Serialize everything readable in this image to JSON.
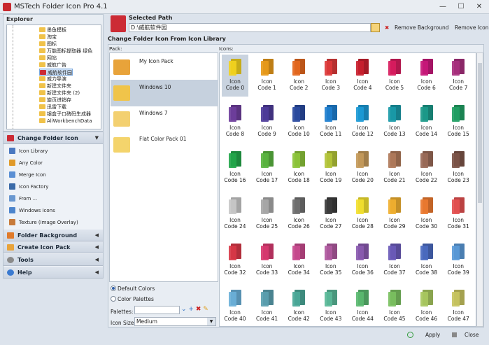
{
  "window": {
    "title": "MSTech Folder Icon Pro 4.1",
    "min": "—",
    "max": "☐",
    "close": "✕"
  },
  "explorer": {
    "title": "Explorer",
    "items": [
      {
        "label": "墨鱼模板"
      },
      {
        "label": "淘宝"
      },
      {
        "label": "图标"
      },
      {
        "label": "万能图标提取器 绿色"
      },
      {
        "label": "网站"
      },
      {
        "label": "威航广告"
      },
      {
        "label": "威航软件园",
        "selected": true
      },
      {
        "label": "威力导演"
      },
      {
        "label": "新建文件夹"
      },
      {
        "label": "新建文件夹 (2)"
      },
      {
        "label": "旋页进销存"
      },
      {
        "label": "迅雷下载"
      },
      {
        "label": "银盒子口碑码生成器"
      },
      {
        "label": "AliWorkbenchData"
      }
    ]
  },
  "nav": {
    "change_folder_icon": "Change Folder Icon",
    "items": [
      {
        "label": "Icon Library",
        "icon": "library-icon",
        "color": "#4a78c0"
      },
      {
        "label": "Any Color",
        "icon": "palette-icon",
        "color": "#e09a2a"
      },
      {
        "label": "Merge Icon",
        "icon": "merge-icon",
        "color": "#5a8fd4"
      },
      {
        "label": "Icon Factory",
        "icon": "factory-icon",
        "color": "#3a6aa8"
      },
      {
        "label": "From ...",
        "icon": "import-icon",
        "color": "#6a98d0"
      },
      {
        "label": "Windows Icons",
        "icon": "windows-icon",
        "color": "#4d85cc"
      },
      {
        "label": "Texture (Image Overlay)",
        "icon": "texture-icon",
        "color": "#c77a3a"
      }
    ],
    "folder_background": "Folder Background",
    "create_icon_pack": "Create Icon Pack",
    "tools": "Tools",
    "help": "Help"
  },
  "selected_path": {
    "title": "Selected Path",
    "value": "D:\\威航软件园",
    "remove_background": "Remove Background",
    "remove_icon": "Remove Icon"
  },
  "library": {
    "title": "Change Folder Icon From Icon Library",
    "pack_label": "Pack:",
    "icons_label": "Icons:",
    "packs": [
      {
        "name": "My Icon Pack",
        "color": "#e8a33a"
      },
      {
        "name": "Windows 10",
        "color": "#f0c44a",
        "selected": true
      },
      {
        "name": "Windows 7",
        "color": "#f3d070"
      },
      {
        "name": "Flat Color Pack 01",
        "color": "#f4d46c"
      }
    ],
    "default_colors": "Default Colors",
    "color_palettes": "Color Palettes",
    "palettes_label": "Palettes:",
    "icon_size_label": "Icon Size:",
    "icon_size_value": "Medium",
    "icon_word": "Icon",
    "icons": [
      {
        "label": "Code 0",
        "color": "#f2d21e"
      },
      {
        "label": "Code 1",
        "color": "#e89a1a"
      },
      {
        "label": "Code 2",
        "color": "#e4681e"
      },
      {
        "label": "Code 3",
        "color": "#dd3a3a"
      },
      {
        "label": "Code 4",
        "color": "#c9202e"
      },
      {
        "label": "Code 5",
        "color": "#d81c5e"
      },
      {
        "label": "Code 6",
        "color": "#c8187a"
      },
      {
        "label": "Code 7",
        "color": "#a8307e"
      },
      {
        "label": "Code 8",
        "color": "#6e3e9c"
      },
      {
        "label": "Code 9",
        "color": "#4e3c9a"
      },
      {
        "label": "Code 10",
        "color": "#2a4aa0"
      },
      {
        "label": "Code 11",
        "color": "#1e7fcf"
      },
      {
        "label": "Code 12",
        "color": "#1c9ad6"
      },
      {
        "label": "Code 13",
        "color": "#1a9aa8"
      },
      {
        "label": "Code 14",
        "color": "#1c9a8a"
      },
      {
        "label": "Code 15",
        "color": "#21a064"
      },
      {
        "label": "Code 16",
        "color": "#23a64a"
      },
      {
        "label": "Code 17",
        "color": "#5ab440"
      },
      {
        "label": "Code 18",
        "color": "#8cc43a"
      },
      {
        "label": "Code 19",
        "color": "#b3c43a"
      },
      {
        "label": "Code 20",
        "color": "#c49a5a"
      },
      {
        "label": "Code 21",
        "color": "#b07a5a"
      },
      {
        "label": "Code 22",
        "color": "#9a6a58"
      },
      {
        "label": "Code 23",
        "color": "#7c5448"
      },
      {
        "label": "Code 24",
        "color": "#c8c8c8"
      },
      {
        "label": "Code 25",
        "color": "#a8a8a8"
      },
      {
        "label": "Code 26",
        "color": "#707070"
      },
      {
        "label": "Code 27",
        "color": "#3c3c3c"
      },
      {
        "label": "Code 28",
        "color": "#f2e030"
      },
      {
        "label": "Code 29",
        "color": "#f0b030"
      },
      {
        "label": "Code 30",
        "color": "#ec7a30"
      },
      {
        "label": "Code 31",
        "color": "#e45050"
      },
      {
        "label": "Code 32",
        "color": "#d83848"
      },
      {
        "label": "Code 33",
        "color": "#d83a70"
      },
      {
        "label": "Code 34",
        "color": "#c84a8e"
      },
      {
        "label": "Code 35",
        "color": "#b05aa0"
      },
      {
        "label": "Code 36",
        "color": "#8a5ab0"
      },
      {
        "label": "Code 37",
        "color": "#6a5ab8"
      },
      {
        "label": "Code 38",
        "color": "#4a6ac0"
      },
      {
        "label": "Code 39",
        "color": "#5a9ad8"
      },
      {
        "label": "Code 40",
        "color": "#6ab0d8"
      },
      {
        "label": "Code 41",
        "color": "#5aa0b0"
      },
      {
        "label": "Code 42",
        "color": "#4aa898"
      },
      {
        "label": "Code 43",
        "color": "#5ab898"
      },
      {
        "label": "Code 44",
        "color": "#5ab870"
      },
      {
        "label": "Code 45",
        "color": "#7ac060"
      },
      {
        "label": "Code 46",
        "color": "#a8c860"
      },
      {
        "label": "Code 47",
        "color": "#c8c460"
      }
    ],
    "apply": "Apply",
    "close": "Close"
  }
}
